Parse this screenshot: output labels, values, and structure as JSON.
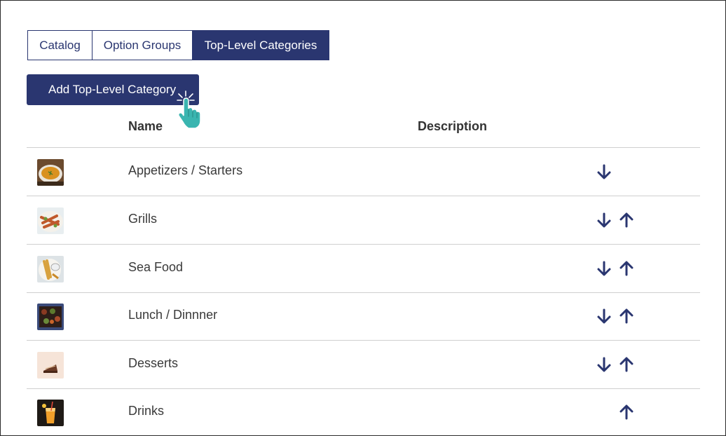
{
  "tabs": [
    {
      "label": "Catalog",
      "active": false
    },
    {
      "label": "Option Groups",
      "active": false
    },
    {
      "label": "Top-Level Categories",
      "active": true
    }
  ],
  "add_button": {
    "label": "Add Top-Level Category"
  },
  "table": {
    "headers": {
      "name": "Name",
      "description": "Description"
    },
    "rows": [
      {
        "name": "Appetizers / Starters",
        "description": "",
        "thumb_icon": "soup-bowl-photo",
        "can_move_down": true,
        "can_move_up": false
      },
      {
        "name": "Grills",
        "description": "",
        "thumb_icon": "grilled-plate-photo",
        "can_move_down": true,
        "can_move_up": true
      },
      {
        "name": "Sea Food",
        "description": "",
        "thumb_icon": "fish-and-chips-photo",
        "can_move_down": true,
        "can_move_up": true
      },
      {
        "name": "Lunch / Dinnner",
        "description": "",
        "thumb_icon": "tray-meal-photo",
        "can_move_down": true,
        "can_move_up": true
      },
      {
        "name": "Desserts",
        "description": "",
        "thumb_icon": "cake-slice-photo",
        "can_move_down": true,
        "can_move_up": true
      },
      {
        "name": "Drinks",
        "description": "",
        "thumb_icon": "cocktail-glass-photo",
        "can_move_down": false,
        "can_move_up": true
      }
    ]
  },
  "colors": {
    "primary": "#2a3670",
    "cursor": "#3ab5b0",
    "divider": "#cfcfcf"
  }
}
